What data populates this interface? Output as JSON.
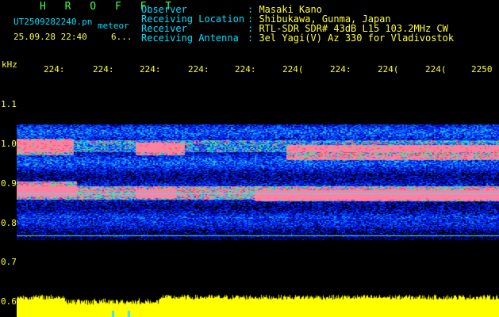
{
  "header": {
    "brand": "H R O F F T",
    "filename": "UT2509282240.pn",
    "filename_suffix": "meteor",
    "datetime": "25.09.28 22:40",
    "count": "6..."
  },
  "info": [
    {
      "key": "Observer",
      "value": "Masaki Kano"
    },
    {
      "key": "Receiving Location",
      "value": "Shibukawa, Gunma, Japan"
    },
    {
      "key": "Receiver",
      "value": "RTL-SDR SDR# 43dB L15 103.2MHz CW"
    },
    {
      "key": "Receiving Antenna",
      "value": "3el Yagi(V) Az 330 for Vladivostok"
    }
  ],
  "axes": {
    "y_unit": "kHz",
    "x_ticks": [
      "224:",
      "224:",
      "224:",
      "224:",
      "224:",
      "224(",
      "224:",
      "224(",
      "224(",
      "2250"
    ],
    "y_ticks": [
      "1.1",
      "1.0",
      "0.9",
      "0.8",
      "0.7",
      "0.6"
    ]
  },
  "colors": {
    "background": "#000000",
    "label": "#00e0ff",
    "value": "#ffff33",
    "brand": "#44ff44"
  }
}
